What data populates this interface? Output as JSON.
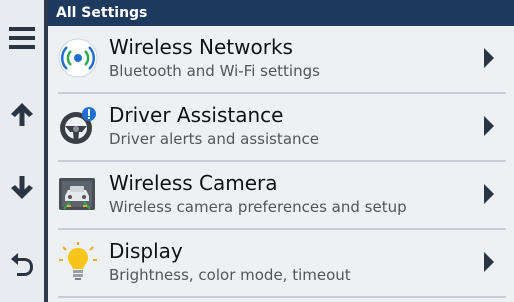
{
  "header": {
    "title": "All Settings"
  },
  "sidebar": {
    "buttons": [
      {
        "icon": "menu-icon"
      },
      {
        "icon": "arrow-up-icon"
      },
      {
        "icon": "arrow-down-icon"
      },
      {
        "icon": "back-icon"
      }
    ]
  },
  "settings": {
    "items": [
      {
        "title": "Wireless Networks",
        "subtitle": "Bluetooth and Wi-Fi settings",
        "icon": "wireless-icon"
      },
      {
        "title": "Driver Assistance",
        "subtitle": "Driver alerts and assistance",
        "icon": "steering-wheel-icon"
      },
      {
        "title": "Wireless Camera",
        "subtitle": "Wireless camera preferences and setup",
        "icon": "camera-icon"
      },
      {
        "title": "Display",
        "subtitle": "Brightness, color mode, timeout",
        "icon": "lightbulb-icon"
      }
    ]
  },
  "colors": {
    "header_bg": "#1e3a5f",
    "list_bg": "#eef1f4",
    "accent": "#1f6fd1"
  }
}
